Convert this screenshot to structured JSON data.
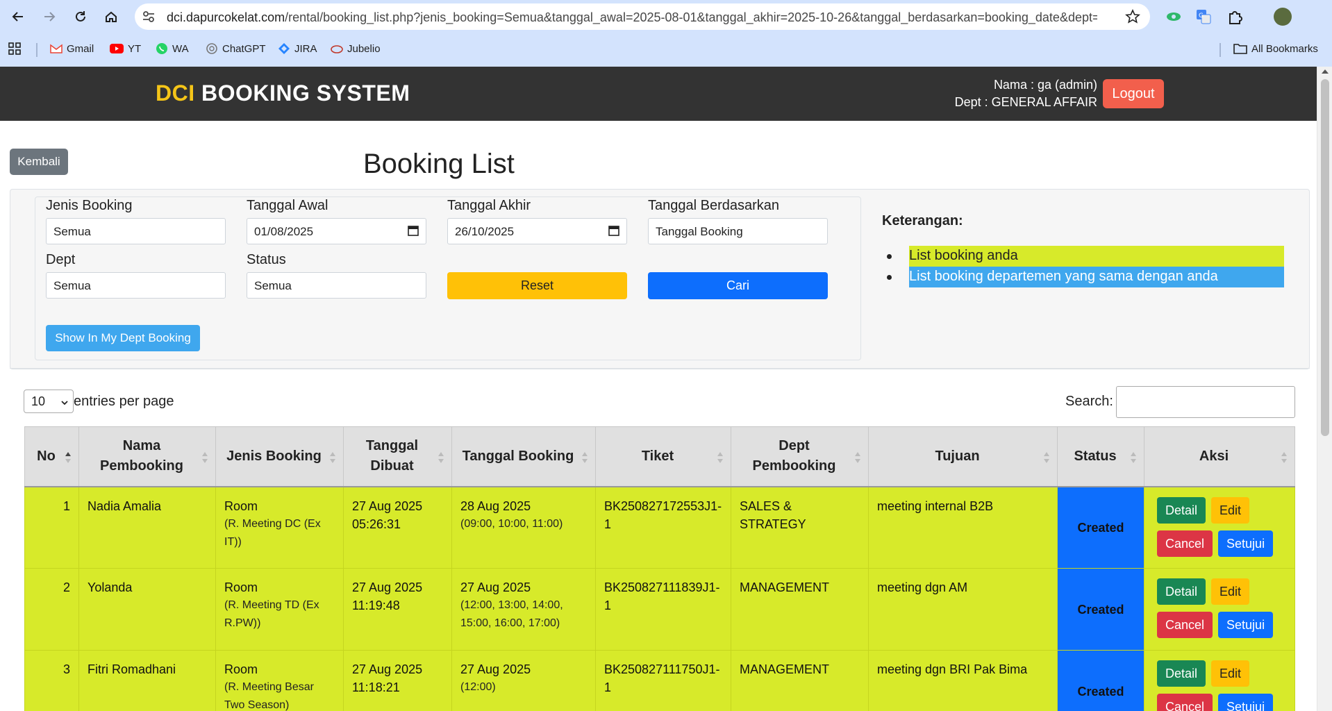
{
  "browser": {
    "url_host": "dci.dapurcokelat.com",
    "url_path": "/rental/booking_list.php?jenis_booking=Semua&tanggal_awal=2025-08-01&tanggal_akhir=2025-10-26&tanggal_berdasarkan=booking_date&dept=Se...",
    "bookmarks": [
      {
        "label": "Gmail",
        "icon": "gmail-icon"
      },
      {
        "label": "YT",
        "icon": "youtube-icon"
      },
      {
        "label": "WA",
        "icon": "whatsapp-icon"
      },
      {
        "label": "ChatGPT",
        "icon": "chatgpt-icon"
      },
      {
        "label": "JIRA",
        "icon": "jira-icon"
      },
      {
        "label": "Jubelio",
        "icon": "jubelio-icon"
      }
    ],
    "all_bookmarks": "All Bookmarks"
  },
  "header": {
    "brand_prefix": "DCI",
    "brand_rest": "BOOKING SYSTEM",
    "user_name": "Nama : ga (admin)",
    "user_dept": "Dept : GENERAL AFFAIR",
    "logout_label": "Logout"
  },
  "page": {
    "back_label": "Kembali",
    "title": "Booking List"
  },
  "filters": {
    "jenis_booking": {
      "label": "Jenis Booking",
      "value": "Semua"
    },
    "tanggal_awal": {
      "label": "Tanggal Awal",
      "value": "01/08/2025"
    },
    "tanggal_akhir": {
      "label": "Tanggal Akhir",
      "value": "26/10/2025"
    },
    "tanggal_berdasarkan": {
      "label": "Tanggal Berdasarkan",
      "value": "Tanggal Booking"
    },
    "dept": {
      "label": "Dept",
      "value": "Semua"
    },
    "status": {
      "label": "Status",
      "value": "Semua"
    },
    "reset_label": "Reset",
    "search_label": "Cari",
    "my_dept_label": "Show In My Dept Booking"
  },
  "legend": {
    "title": "Keterangan:",
    "own": "List booking anda",
    "dept": "List booking departemen yang sama dengan anda",
    "own_color": "#d7ea2a",
    "dept_color": "#3fa7ee"
  },
  "table_controls": {
    "entries_value": "10",
    "entries_label": "entries per page",
    "search_label": "Search:"
  },
  "table": {
    "columns": {
      "no": "No",
      "nama": "Nama Pembooking",
      "jenis": "Jenis Booking",
      "dibuat": "Tanggal Dibuat",
      "booking": "Tanggal Booking",
      "tiket": "Tiket",
      "dept": "Dept Pembooking",
      "tujuan": "Tujuan",
      "status": "Status",
      "aksi": "Aksi"
    },
    "rows": [
      {
        "no": "1",
        "nama": "Nadia Amalia",
        "jenis": "Room",
        "jenis_detail": "(R. Meeting DC (Ex IT))",
        "dibuat_date": "27 Aug 2025",
        "dibuat_time": "05:26:31",
        "booking_date": "28 Aug 2025",
        "booking_slots": "(09:00, 10:00, 11:00)",
        "tiket": "BK250827172553J1-1",
        "dept": "SALES & STRATEGY",
        "tujuan": "meeting internal B2B",
        "status": "Created"
      },
      {
        "no": "2",
        "nama": "Yolanda",
        "jenis": "Room",
        "jenis_detail": "(R. Meeting TD (Ex R.PW))",
        "dibuat_date": "27 Aug 2025",
        "dibuat_time": "11:19:48",
        "booking_date": "27 Aug 2025",
        "booking_slots": "(12:00, 13:00, 14:00, 15:00, 16:00, 17:00)",
        "tiket": "BK250827111839J1-1",
        "dept": "MANAGEMENT",
        "tujuan": "meeting dgn AM",
        "status": "Created"
      },
      {
        "no": "3",
        "nama": "Fitri Romadhani",
        "jenis": "Room",
        "jenis_detail": "(R. Meeting Besar Two Season)",
        "dibuat_date": "27 Aug 2025",
        "dibuat_time": "11:18:21",
        "booking_date": "27 Aug 2025",
        "booking_slots": "(12:00)",
        "tiket": "BK250827111750J1-1",
        "dept": "MANAGEMENT",
        "tujuan": "meeting dgn BRI Pak Bima",
        "status": "Created"
      }
    ],
    "actions": {
      "detail": "Detail",
      "edit": "Edit",
      "cancel": "Cancel",
      "approve": "Setujui"
    }
  }
}
